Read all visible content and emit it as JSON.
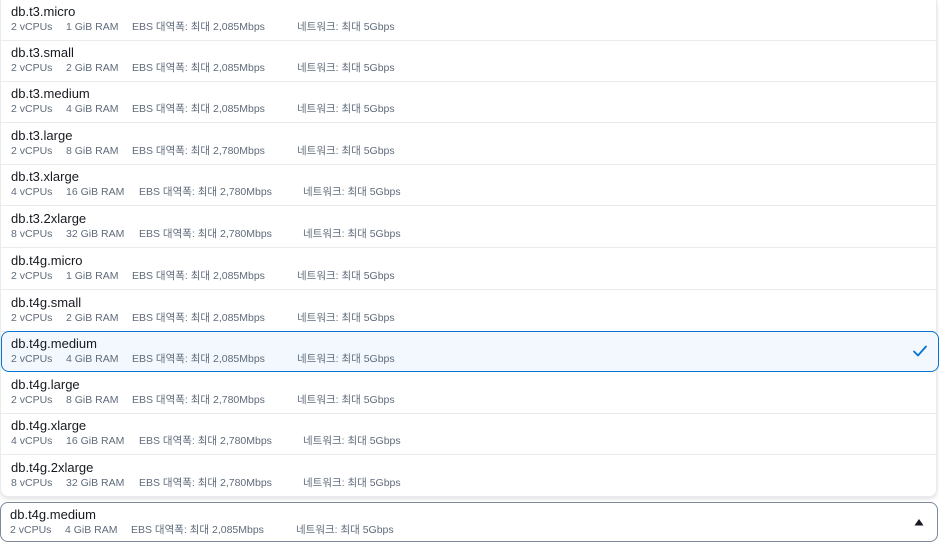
{
  "colors": {
    "accent": "#0972d3",
    "selected_bg": "#f2f8fd",
    "text_primary": "#16191f",
    "text_secondary": "#5f6b7a",
    "divider": "#e9ebed"
  },
  "options": [
    {
      "name": "db.t3.micro",
      "vcpu": "2 vCPUs",
      "ram": "1 GiB RAM",
      "ebs": "EBS 대역폭: 최대 2,085Mbps",
      "network": "네트워크: 최대 5Gbps"
    },
    {
      "name": "db.t3.small",
      "vcpu": "2 vCPUs",
      "ram": "2 GiB RAM",
      "ebs": "EBS 대역폭: 최대 2,085Mbps",
      "network": "네트워크: 최대 5Gbps"
    },
    {
      "name": "db.t3.medium",
      "vcpu": "2 vCPUs",
      "ram": "4 GiB RAM",
      "ebs": "EBS 대역폭: 최대 2,085Mbps",
      "network": "네트워크: 최대 5Gbps"
    },
    {
      "name": "db.t3.large",
      "vcpu": "2 vCPUs",
      "ram": "8 GiB RAM",
      "ebs": "EBS 대역폭: 최대 2,780Mbps",
      "network": "네트워크: 최대 5Gbps"
    },
    {
      "name": "db.t3.xlarge",
      "vcpu": "4 vCPUs",
      "ram": "16 GiB RAM",
      "ebs": "EBS 대역폭: 최대 2,780Mbps",
      "network": "네트워크: 최대 5Gbps"
    },
    {
      "name": "db.t3.2xlarge",
      "vcpu": "8 vCPUs",
      "ram": "32 GiB RAM",
      "ebs": "EBS 대역폭: 최대 2,780Mbps",
      "network": "네트워크: 최대 5Gbps"
    },
    {
      "name": "db.t4g.micro",
      "vcpu": "2 vCPUs",
      "ram": "1 GiB RAM",
      "ebs": "EBS 대역폭: 최대 2,085Mbps",
      "network": "네트워크: 최대 5Gbps"
    },
    {
      "name": "db.t4g.small",
      "vcpu": "2 vCPUs",
      "ram": "2 GiB RAM",
      "ebs": "EBS 대역폭: 최대 2,085Mbps",
      "network": "네트워크: 최대 5Gbps"
    },
    {
      "name": "db.t4g.medium",
      "vcpu": "2 vCPUs",
      "ram": "4 GiB RAM",
      "ebs": "EBS 대역폭: 최대 2,085Mbps",
      "network": "네트워크: 최대 5Gbps",
      "selected": true
    },
    {
      "name": "db.t4g.large",
      "vcpu": "2 vCPUs",
      "ram": "8 GiB RAM",
      "ebs": "EBS 대역폭: 최대 2,780Mbps",
      "network": "네트워크: 최대 5Gbps"
    },
    {
      "name": "db.t4g.xlarge",
      "vcpu": "4 vCPUs",
      "ram": "16 GiB RAM",
      "ebs": "EBS 대역폭: 최대 2,780Mbps",
      "network": "네트워크: 최대 5Gbps"
    },
    {
      "name": "db.t4g.2xlarge",
      "vcpu": "8 vCPUs",
      "ram": "32 GiB RAM",
      "ebs": "EBS 대역폭: 최대 2,780Mbps",
      "network": "네트워크: 최대 5Gbps"
    }
  ],
  "selected_value": {
    "name": "db.t4g.medium",
    "vcpu": "2 vCPUs",
    "ram": "4 GiB RAM",
    "ebs": "EBS 대역폭: 최대 2,085Mbps",
    "network": "네트워크: 최대 5Gbps"
  },
  "icons": {
    "selected_marker": "check-icon",
    "trigger_caret": "caret-up-icon"
  }
}
